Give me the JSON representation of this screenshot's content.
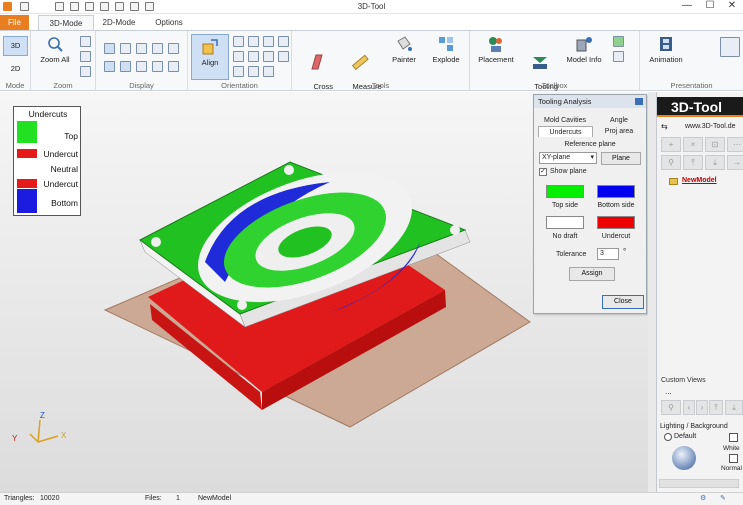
{
  "window": {
    "title": "3D-Tool",
    "minimize": "—",
    "maximize": "☐",
    "close": "✕"
  },
  "tabs": [
    "File",
    "3D-Mode",
    "2D-Mode",
    "Options"
  ],
  "ribbon": {
    "mode": {
      "label": "Mode",
      "btn3d": "3D",
      "btn2d": "2D"
    },
    "zoom": {
      "label": "Zoom",
      "zoom_all": "Zoom All"
    },
    "display": {
      "label": "Display"
    },
    "orientation": {
      "label": "Orientation",
      "align": "Align"
    },
    "tools": {
      "label": "Tools",
      "cross_section": "Cross\nSection",
      "measure_markup": "Measure\nMarkup",
      "painter": "Painter",
      "explode": "Explode"
    },
    "toolbox": {
      "label": "Toolbox",
      "placement": "Placement",
      "tooling_analysis": "Tooling\nAnalysis",
      "model_info": "Model Info"
    },
    "presentation": {
      "label": "Presentation",
      "animation": "Animation"
    }
  },
  "legend": {
    "title": "Undercuts",
    "items": [
      {
        "label": "Top",
        "color": "#22e022"
      },
      {
        "label": "Undercut",
        "color": "#e51b1b"
      },
      {
        "label": "Neutral",
        "color": "#ffffff"
      },
      {
        "label": "Undercut",
        "color": "#e51b1b"
      },
      {
        "label": "Bottom",
        "color": "#1c1ce0"
      }
    ]
  },
  "tooling": {
    "title": "Tooling Analysis",
    "tabs_row1": [
      "Mold Cavities",
      "Angle"
    ],
    "tabs_row2": [
      "Undercuts",
      "Proj area"
    ],
    "ref_plane_label": "Reference plane",
    "plane_select": "XY-plane",
    "plane_btn": "Plane",
    "show_plane": "Show plane",
    "top_side": "Top side",
    "bottom_side": "Bottom side",
    "no_draft": "No draft",
    "undercut": "Undercut",
    "tolerance_label": "Tolerance",
    "tolerance_value": "3",
    "tolerance_unit": "°",
    "assign": "Assign",
    "close": "Close",
    "colors": {
      "top": "#00ee00",
      "bottom": "#0000ee",
      "no_draft": "#ffffff",
      "undercut": "#ee0000"
    }
  },
  "rpanel": {
    "logo": "3D-Tool",
    "url": "www.3D-Tool.de",
    "tree_item": "NewModel",
    "custom_views": "Custom Views",
    "custom_views_value": "...",
    "lighting": "Lighting / Background",
    "default": "Default",
    "white": "White",
    "normal": "Normal"
  },
  "status": {
    "triangles_label": "Triangles:",
    "triangles": "10020",
    "files_label": "Files:",
    "files": "1",
    "model": "NewModel"
  },
  "axes": {
    "x": "X",
    "y": "Y",
    "z": "Z"
  }
}
